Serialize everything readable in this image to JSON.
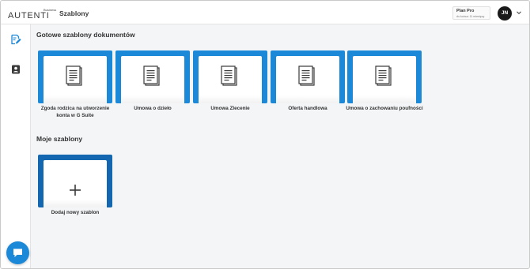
{
  "header": {
    "logo_business": "Business",
    "logo_text": "AUTENTI",
    "title": "Szablony",
    "plan": {
      "name": "Plan Pro",
      "subtitle": "do końca: 11 miesięcy"
    },
    "avatar_initials": "JN"
  },
  "sidebar": {
    "items": [
      {
        "icon": "document-edit-icon",
        "active": true
      },
      {
        "icon": "contacts-icon",
        "active": false
      }
    ],
    "chat_icon": "chat-bubble-icon"
  },
  "ready_templates": {
    "title": "Gotowe szablony dokumentów",
    "cards": [
      {
        "label": "Zgoda rodzica na utworzenie konta w G Suite"
      },
      {
        "label": "Umowa o dzieło"
      },
      {
        "label": "Umowa Zlecenie"
      },
      {
        "label": "Oferta handlowa"
      },
      {
        "label": "Umowa o zachowaniu poufności"
      }
    ]
  },
  "my_templates": {
    "title": "Moje szablony",
    "add_label": "Dodaj nowy szablon"
  },
  "colors": {
    "accent": "#1c88d8",
    "accent_dark": "#1367b0",
    "sidebar_active": "#1c88d8",
    "background": "#f4f5f7"
  }
}
